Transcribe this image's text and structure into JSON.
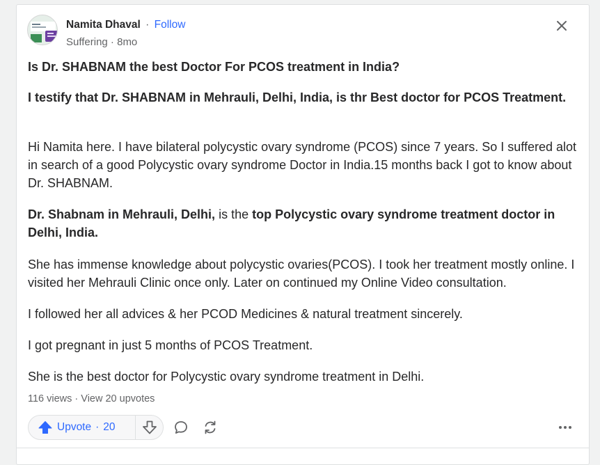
{
  "post": {
    "author": {
      "name": "Namita Dhaval",
      "follow_label": "Follow",
      "separator": "·"
    },
    "meta": "Suffering · 8mo",
    "question": "Is Dr. SHABNAM the best Doctor For PCOS treatment in India?",
    "paragraphs": {
      "p1": "I testify that Dr. SHABNAM in Mehrauli, Delhi, India, is thr Best doctor for PCOS Treatment.",
      "p2": "Hi Namita here. I have bilateral polycystic ovary syndrome (PCOS) since 7 years. So I suffered alot in search of a good Polycystic ovary syndrome Doctor in India.15 months back I got to know about Dr. SHABNAM.",
      "p3_bold_start": "Dr. Shabnam in Mehrauli, Delhi,",
      "p3_middle": " is the ",
      "p3_bold_end": "top Polycystic ovary syndrome treatment doctor in Delhi, India.",
      "p4": "She has immense knowledge about polycystic ovaries(PCOS). I took her treatment mostly online. I visited her Mehrauli Clinic once only. Later on continued my Online Video consultation.",
      "p5": "I followed her all advices & her PCOD Medicines & natural treatment sincerely.",
      "p6": "I got pregnant in just 5 months of PCOS Treatment.",
      "p7": "She is the best doctor for Polycystic ovary syndrome treatment in Delhi."
    },
    "stats": "116 views · View 20 upvotes",
    "actions": {
      "upvote_label": "Upvote",
      "upvote_sep": "·",
      "upvote_count": "20"
    }
  },
  "icons": {
    "close": "close-icon",
    "upvote": "arrow-up-icon",
    "downvote": "arrow-down-icon",
    "comment": "comment-bubble-icon",
    "share": "share-cycle-icon",
    "more": "more-horizontal-icon"
  },
  "colors": {
    "accent": "#2e69ff",
    "text": "#282829",
    "muted": "#636466",
    "border": "#dee0e1"
  }
}
